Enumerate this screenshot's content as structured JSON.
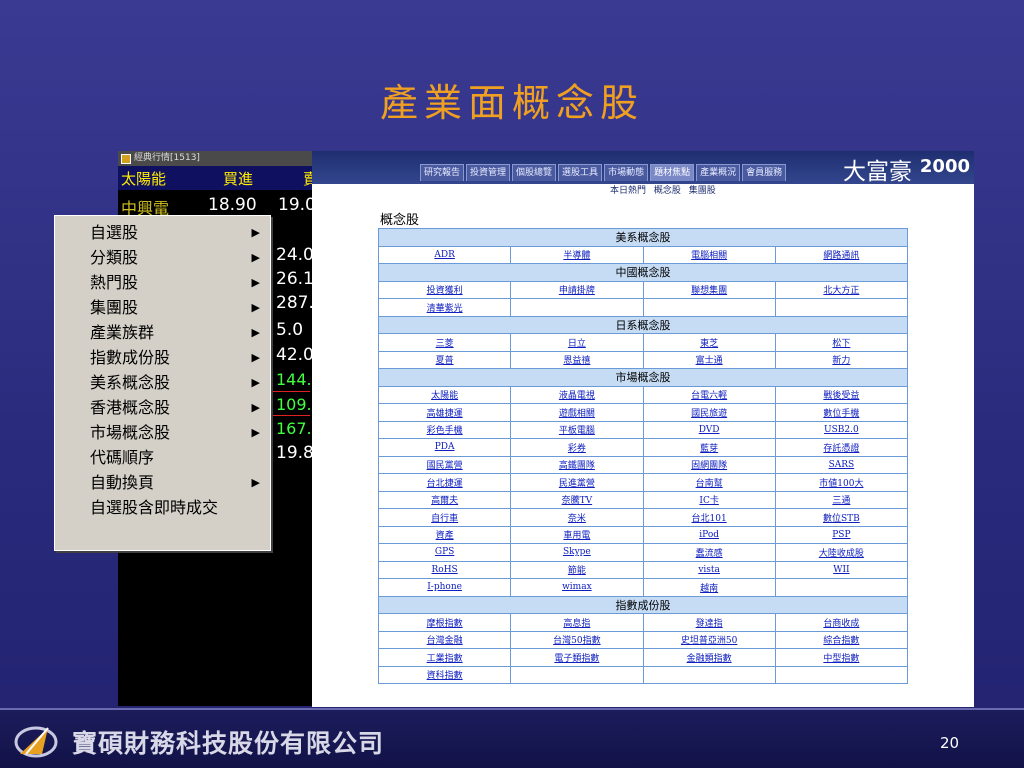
{
  "slide": {
    "title": "產業面概念股",
    "page_number": "20"
  },
  "quote_window": {
    "title": "經典行情[1513]",
    "header": {
      "name": "太陽能",
      "buy": "買進",
      "sell": "賣"
    },
    "rows": [
      {
        "name": "中興電",
        "price": "18.90",
        "partial": "19.0"
      }
    ],
    "right_values": [
      "24.0",
      "26.1",
      "287.",
      "5.0",
      "42.0",
      "144.",
      "109.",
      "167.",
      "19.8"
    ]
  },
  "context_menu": {
    "items": [
      {
        "label": "自選股",
        "arrow": "▶"
      },
      {
        "label": "分類股",
        "arrow": "▶"
      },
      {
        "label": "熱門股",
        "arrow": "▶"
      },
      {
        "label": "集團股",
        "arrow": "▶"
      },
      {
        "label": "產業族群",
        "arrow": "▶"
      },
      {
        "label": "指數成份股",
        "arrow": "▶"
      },
      {
        "label": "美系概念股",
        "arrow": "▶"
      },
      {
        "label": "香港概念股",
        "arrow": "▶"
      },
      {
        "label": "市場概念股",
        "arrow": "▶"
      },
      {
        "label": "代碼順序",
        "arrow": ""
      },
      {
        "label": "自動換頁",
        "arrow": "▶"
      },
      {
        "label": "自選股含即時成交",
        "arrow": ""
      }
    ]
  },
  "web": {
    "nav_tabs": [
      "研究報告",
      "投資管理",
      "個股總覽",
      "選股工具",
      "市場動態",
      "題材焦點",
      "產業概況",
      "會員服務"
    ],
    "active_tab": "題材焦點",
    "brand": "大富豪",
    "brand_num": "2000",
    "subnav": [
      "本日熱門",
      "概念股",
      "集團股"
    ],
    "section_title": "概念股",
    "sections": [
      {
        "category": "美系概念股",
        "rows": [
          [
            "ADR",
            "半導體",
            "電腦相關",
            "網路通訊"
          ]
        ]
      },
      {
        "category": "中國概念股",
        "rows": [
          [
            "投資獲利",
            "申請掛牌",
            "聯想集團",
            "北大方正"
          ],
          [
            "清華紫光",
            "",
            "",
            ""
          ]
        ]
      },
      {
        "category": "日系概念股",
        "rows": [
          [
            "三菱",
            "日立",
            "東芝",
            "松下"
          ],
          [
            "夏普",
            "恩益禧",
            "富士通",
            "新力"
          ]
        ]
      },
      {
        "category": "市場概念股",
        "rows": [
          [
            "太陽能",
            "液晶電視",
            "台電六輕",
            "戰後受益"
          ],
          [
            "高雄捷運",
            "遊戲相關",
            "國民旅遊",
            "數位手機"
          ],
          [
            "彩色手機",
            "平板電腦",
            "DVD",
            "USB2.0"
          ],
          [
            "PDA",
            "彩券",
            "藍芽",
            "存託憑證"
          ],
          [
            "國民黨營",
            "高鐵團隊",
            "固網團隊",
            "SARS"
          ],
          [
            "台北捷運",
            "民進黨營",
            "台南幫",
            "市値100大"
          ],
          [
            "高爾夫",
            "奈騰TV",
            "IC卡",
            "三通"
          ],
          [
            "自行車",
            "奈米",
            "台北101",
            "數位STB"
          ],
          [
            "資產",
            "車用電",
            "iPod",
            "PSP"
          ],
          [
            "GPS",
            "Skype",
            "蠢流感",
            "大陸收成股"
          ],
          [
            "RoHS",
            "節能",
            "vista",
            "WII"
          ],
          [
            "I-phone",
            "wimax",
            "越南",
            ""
          ]
        ]
      },
      {
        "category": "指數成份股",
        "rows": [
          [
            "摩根指數",
            "高息指",
            "發達指",
            "台商收成"
          ],
          [
            "台灣金融",
            "台灣50指數",
            "史坦普亞洲50",
            "綜合指數"
          ],
          [
            "工業指數",
            "電子類指數",
            "金融類指數",
            "中型指數"
          ],
          [
            "資科指數",
            "",
            "",
            ""
          ]
        ]
      }
    ]
  },
  "footer": {
    "company": "寶碩財務科技股份有限公司"
  },
  "colors": {
    "title": "#f0a020",
    "background": "#2b2b7e",
    "table_header": "#c6dcf4",
    "link": "#1020c0"
  }
}
